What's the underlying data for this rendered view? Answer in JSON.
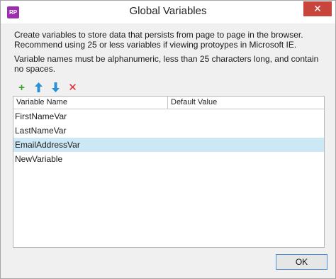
{
  "window": {
    "title": "Global Variables",
    "app_icon_text": "RP",
    "close_glyph": "✕"
  },
  "description": {
    "line1": "Create variables to store data that persists from page to page in the browser. Recommend using 25 or less variables if viewing protoypes in Microsoft IE.",
    "line2": "Variable names must be alphanumeric, less than 25 characters long, and contain no spaces."
  },
  "toolbar": {
    "add": {
      "icon": "plus-icon",
      "glyph": "+",
      "color": "#3aa12b"
    },
    "move_up": {
      "icon": "arrow-up-icon",
      "glyph": "🡑",
      "color": "#2f8fd6"
    },
    "move_down": {
      "icon": "arrow-down-icon",
      "glyph": "🡓",
      "color": "#2f8fd6"
    },
    "delete": {
      "icon": "delete-icon",
      "glyph": "✕",
      "color": "#e0282b"
    }
  },
  "grid": {
    "columns": [
      "Variable Name",
      "Default Value"
    ],
    "rows": [
      {
        "name": "FirstNameVar",
        "value": ""
      },
      {
        "name": "LastNameVar",
        "value": ""
      },
      {
        "name": "EmailAddressVar",
        "value": "",
        "selected": true
      },
      {
        "name": "NewVariable",
        "value": ""
      }
    ]
  },
  "buttons": {
    "ok": "OK"
  }
}
